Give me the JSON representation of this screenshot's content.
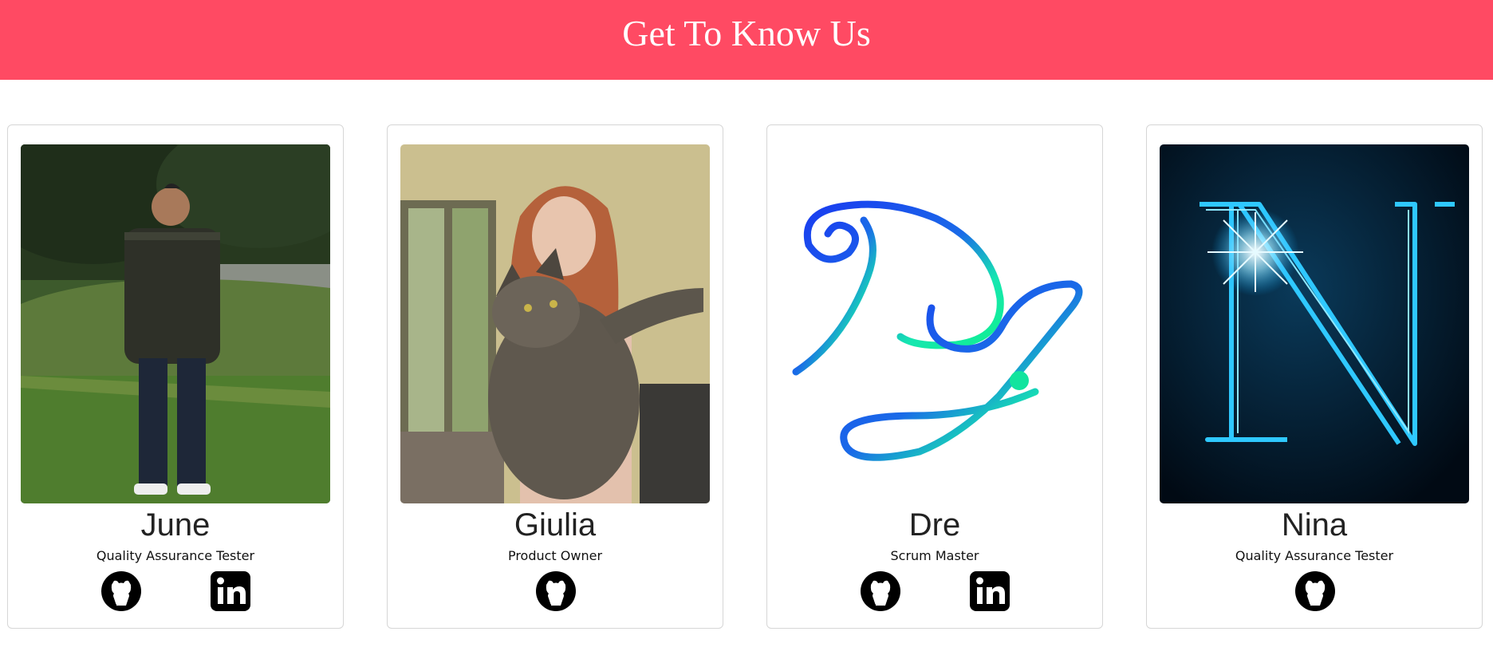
{
  "header": {
    "title": "Get To Know Us",
    "background": "#ff4a63"
  },
  "team": [
    {
      "name": "June",
      "role": "Quality Assurance Tester",
      "photo": "man-in-garden-photo",
      "links": [
        "github-icon",
        "linkedin-icon"
      ]
    },
    {
      "name": "Giulia",
      "role": "Product Owner",
      "photo": "woman-holding-cat-photo",
      "links": [
        "github-icon"
      ]
    },
    {
      "name": "Dre",
      "role": "Scrum Master",
      "photo": "calligraphy-monogram-logo",
      "links": [
        "github-icon",
        "linkedin-icon"
      ]
    },
    {
      "name": "Nina",
      "role": "Quality Assurance Tester",
      "photo": "neon-letter-n-logo",
      "links": [
        "github-icon"
      ]
    }
  ]
}
